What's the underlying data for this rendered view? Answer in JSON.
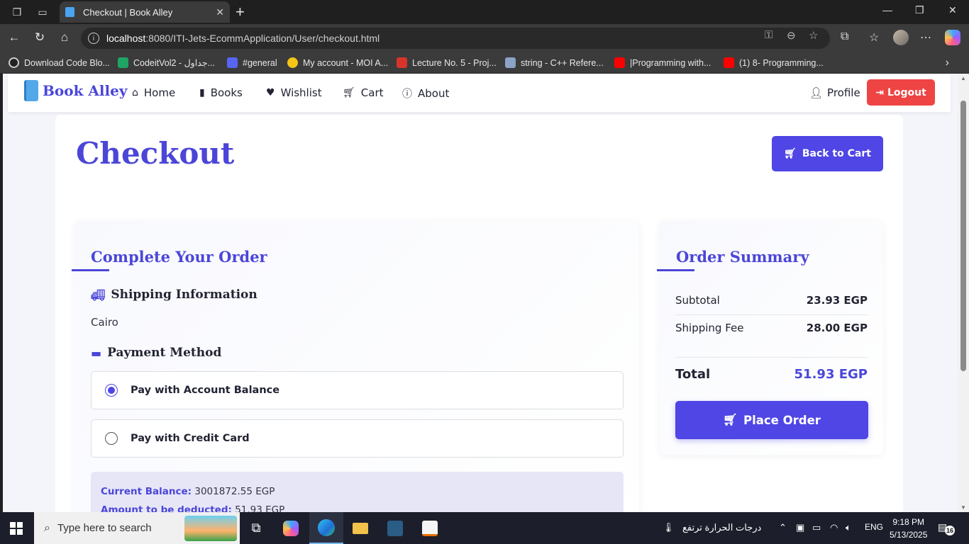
{
  "browser": {
    "tab_title": "Checkout | Book Alley",
    "url_host": "localhost",
    "url_rest": ":8080/ITI-Jets-EcommApplication/User/checkout.html",
    "bookmarks": [
      "Download Code Blo...",
      "CodeitVol2 - جداول...",
      "#general",
      "My account - MOI A...",
      "Lecture No. 5 - Proj...",
      "string - C++ Refere...",
      "|Programming with...",
      "(1) 8- Programming..."
    ]
  },
  "nav": {
    "brand": "Book Alley",
    "links": [
      "Home",
      "Books",
      "Wishlist",
      "Cart",
      "About"
    ],
    "profile": "Profile",
    "logout": "Logout"
  },
  "page": {
    "title": "Checkout",
    "back_to_cart": "Back to Cart"
  },
  "order_form": {
    "heading": "Complete Your Order",
    "shipping_heading": "Shipping Information",
    "shipping_city": "Cairo",
    "payment_heading": "Payment Method",
    "payment_options": [
      {
        "label": "Pay with Account Balance",
        "selected": true
      },
      {
        "label": "Pay with Credit Card",
        "selected": false
      }
    ],
    "balance": {
      "current_label": "Current Balance:",
      "current_value": "3001872.55 EGP",
      "deduct_label": "Amount to be deducted:",
      "deduct_value": "51.93 EGP"
    }
  },
  "summary": {
    "heading": "Order Summary",
    "subtotal_label": "Subtotal",
    "subtotal_value": "23.93 EGP",
    "shipping_label": "Shipping Fee",
    "shipping_value": "28.00 EGP",
    "total_label": "Total",
    "total_value": "51.93 EGP",
    "place_order": "Place Order"
  },
  "taskbar": {
    "search_placeholder": "Type here to search",
    "weather": "درجات الحرارة ترتفع",
    "lang": "ENG",
    "time": "9:18 PM",
    "date": "5/13/2025",
    "notifications": "16"
  },
  "colors": {
    "accent": "#4f46e5",
    "heading": "#4b46d8",
    "danger": "#ef4444"
  }
}
